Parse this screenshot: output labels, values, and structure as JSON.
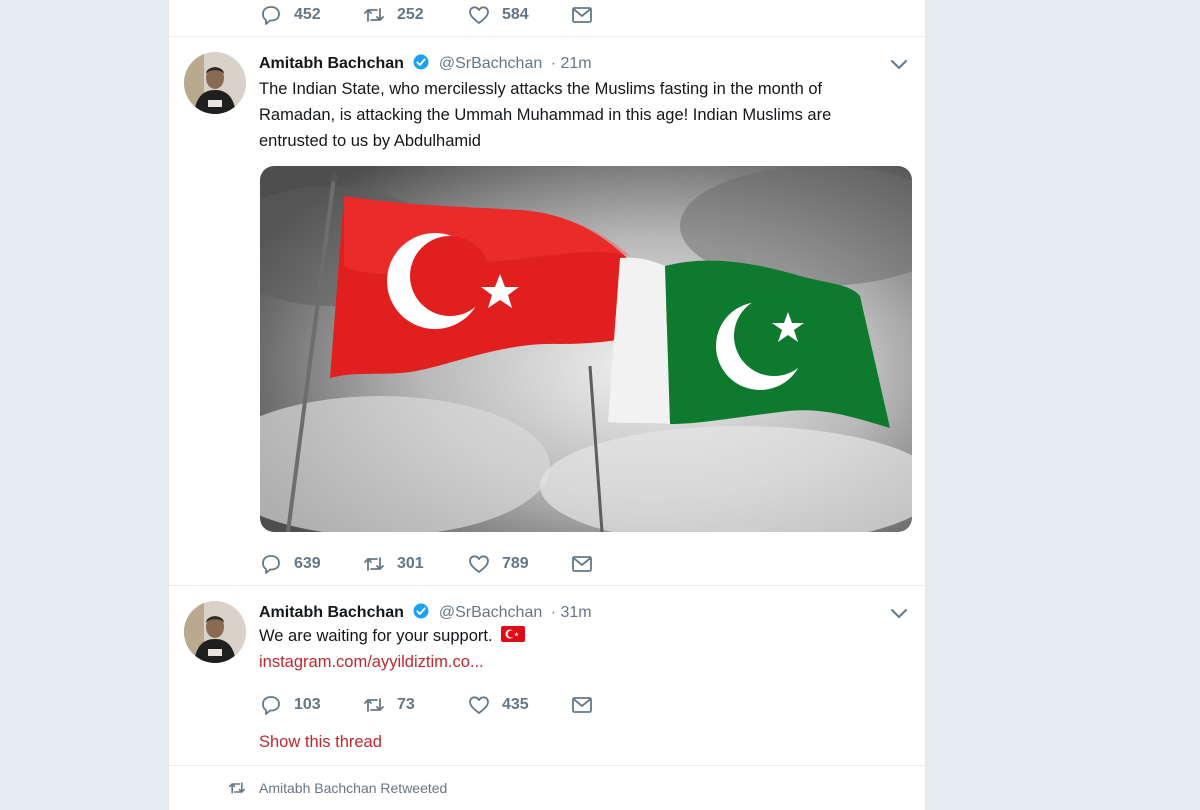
{
  "colors": {
    "accent": "#1da1f2",
    "link": "#c0282d",
    "muted": "#657786"
  },
  "prev_tweet": {
    "replies": "452",
    "retweets": "252",
    "likes": "584"
  },
  "tweet1": {
    "name": "Amitabh Bachchan",
    "handle": "@SrBachchan",
    "time": "· 21m",
    "text": "The Indian State, who mercilessly attacks the Muslims fasting in the month of Ramadan, is attacking the Ummah Muhammad in this age! Indian Muslims are entrusted to us by Abdulhamid",
    "replies": "639",
    "retweets": "301",
    "likes": "789"
  },
  "tweet2": {
    "name": "Amitabh Bachchan",
    "handle": "@SrBachchan",
    "time": "· 31m",
    "text": "We are waiting for your support.",
    "link": "instagram.com/ayyildiztim.co...",
    "replies": "103",
    "retweets": "73",
    "likes": "435",
    "thread": "Show this thread"
  },
  "retweet_context": {
    "label": "Amitabh Bachchan Retweeted"
  },
  "icons": [
    "reply-icon",
    "retweet-icon",
    "like-icon",
    "dm-icon",
    "verified-icon",
    "chevron-down-icon",
    "flag-turkey-icon"
  ]
}
